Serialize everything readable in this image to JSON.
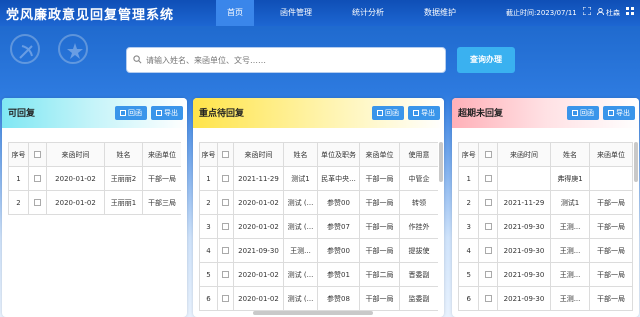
{
  "app": {
    "title": "党风廉政意见回复管理系统"
  },
  "nav": [
    {
      "label": "首页",
      "active": true
    },
    {
      "label": "函件管理",
      "active": false
    },
    {
      "label": "统计分析",
      "active": false
    },
    {
      "label": "数据维护",
      "active": false
    }
  ],
  "header_right": {
    "deadline": "截止时间:2023/07/11",
    "fullscreen_icon": "fullscreen-icon",
    "user_icon": "user-icon",
    "user": "杜森",
    "menu_icon": "menu-icon"
  },
  "search": {
    "placeholder": "请输入姓名、来函单位、文号……",
    "button": "查询办理"
  },
  "panels": {
    "replied": {
      "title": "可回复",
      "buttons": [
        "回函",
        "导出"
      ],
      "headers": [
        "序号",
        "",
        "来函时间",
        "姓名",
        "来函单位"
      ],
      "rows": [
        [
          "1",
          "",
          "2020-01-02",
          "王丽丽2",
          "干部一局"
        ],
        [
          "2",
          "",
          "2020-01-02",
          "王丽丽1",
          "干部三局"
        ]
      ]
    },
    "pending": {
      "title": "重点待回复",
      "buttons": [
        "回函",
        "导出"
      ],
      "headers": [
        "序号",
        "",
        "来函时间",
        "姓名",
        "单位及职务",
        "来函单位",
        "使用意"
      ],
      "rows": [
        [
          "1",
          "",
          "2021-11-29",
          "测试1",
          "民革中央...",
          "干部一局",
          "中管企"
        ],
        [
          "2",
          "",
          "2020-01-02",
          "测试 (...",
          "参赞00",
          "干部一局",
          "转领"
        ],
        [
          "3",
          "",
          "2020-01-02",
          "测试 (...",
          "参赞07",
          "干部一局",
          "作挂外"
        ],
        [
          "4",
          "",
          "2021-09-30",
          "王测...",
          "参赞00",
          "干部一局",
          "提拔使"
        ],
        [
          "5",
          "",
          "2020-01-02",
          "测试 (...",
          "参赞01",
          "干部二局",
          "晋委副"
        ],
        [
          "6",
          "",
          "2020-01-02",
          "测试 (...",
          "参赞08",
          "干部一局",
          "监委副"
        ]
      ]
    },
    "overdue": {
      "title": "超期未回复",
      "buttons": [
        "回函",
        "导出"
      ],
      "headers": [
        "序号",
        "",
        "来函时间",
        "姓名",
        "来函单位"
      ],
      "rows": [
        [
          "1",
          "",
          "",
          "弗得庚1",
          ""
        ],
        [
          "2",
          "",
          "2021-11-29",
          "测试1",
          "干部一局"
        ],
        [
          "3",
          "",
          "2021-09-30",
          "王测...",
          "干部一局"
        ],
        [
          "4",
          "",
          "2021-09-30",
          "王测...",
          "干部一局"
        ],
        [
          "5",
          "",
          "2021-09-30",
          "王测...",
          "干部一局"
        ],
        [
          "6",
          "",
          "2021-09-30",
          "王测...",
          "干部一局"
        ]
      ]
    }
  },
  "colors": {
    "brand": "#1a64c8",
    "button": "#3a95ea",
    "search_button": "#3ab1f0"
  }
}
